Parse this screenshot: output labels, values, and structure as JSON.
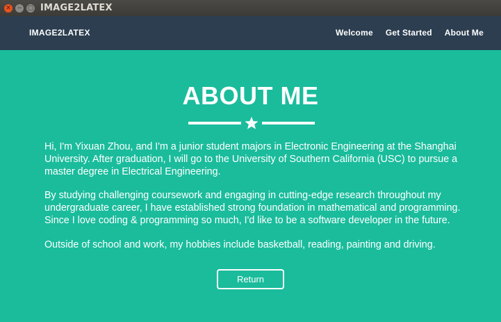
{
  "window": {
    "title": "IMAGE2LATEX"
  },
  "navbar": {
    "brand": "IMAGE2LATEX",
    "links": [
      "Welcome",
      "Get Started",
      "About Me"
    ]
  },
  "about": {
    "heading": "ABOUT ME",
    "divider_icon": "star-icon",
    "paragraphs": [
      "Hi, I'm Yixuan Zhou, and I'm a junior student majors in Electronic Engineering at the Shanghai University. After graduation, I will go to the University of Southern California (USC) to pursue a master degree in Electrical Engineering.",
      "By studying challenging coursework and engaging in cutting-edge research throughout my undergraduate career, I have established strong foundation in mathematical and programming. Since I love coding & programming so much, I'd like to be a software developer in the future.",
      "Outside of school and work, my hobbies include basketball, reading, painting and driving."
    ],
    "return_label": "Return"
  },
  "colors": {
    "primary": "#1abc9c",
    "navbar": "#2c3e50",
    "text": "#ffffff",
    "close_button": "#e95420"
  }
}
